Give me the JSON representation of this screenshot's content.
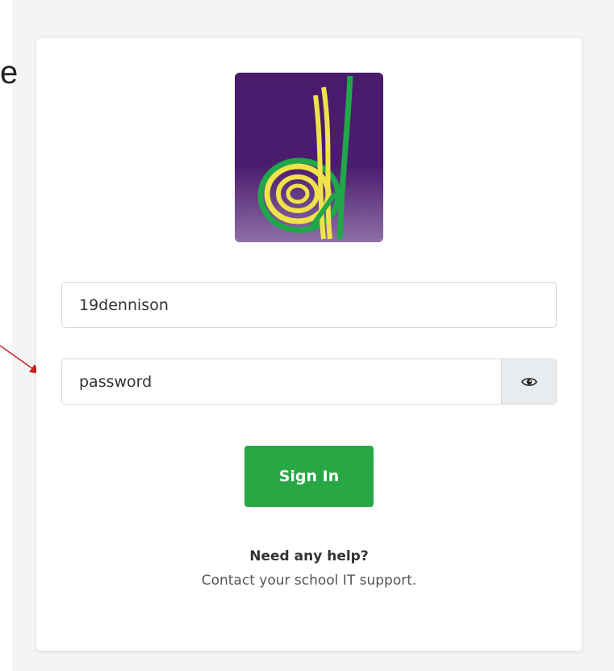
{
  "background": {
    "partial_text": "e"
  },
  "login": {
    "username_value": "19dennison",
    "password_value": "password",
    "show_password_icon": "eye-icon",
    "signin_label": "Sign In",
    "help_title": "Need any help?",
    "help_text": "Contact your school IT support."
  },
  "colors": {
    "primary_button": "#28a745",
    "logo_purple": "#4a1a6b",
    "logo_green": "#1fa84a",
    "logo_yellow": "#f0e24a",
    "annotation_arrow": "#d22020"
  }
}
